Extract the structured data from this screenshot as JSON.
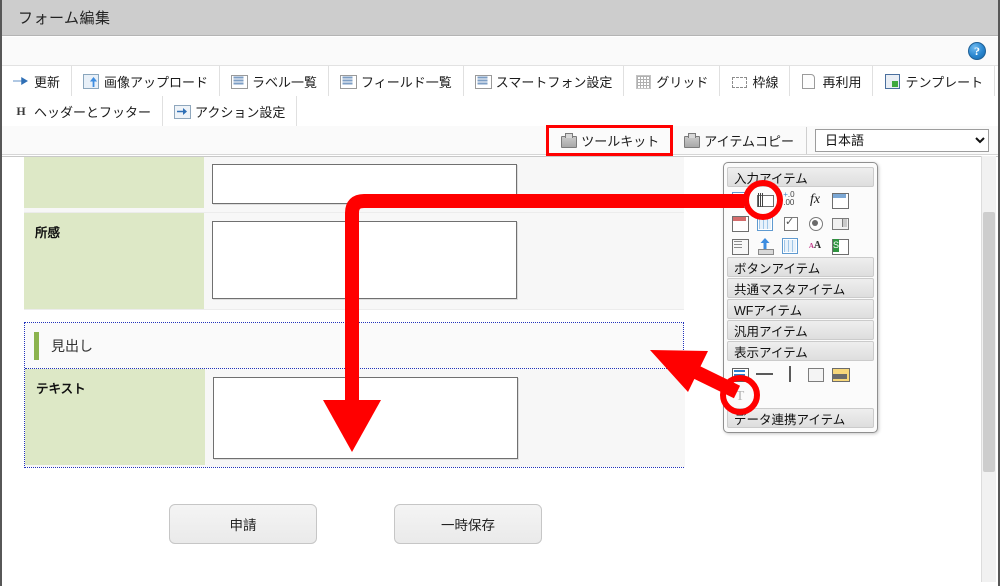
{
  "window": {
    "title": "フォーム編集",
    "help_icon_label": "?"
  },
  "toolbar": {
    "row1": [
      {
        "label": "更新",
        "icon": "refresh-icon"
      },
      {
        "label": "画像アップロード",
        "icon": "image-upload-icon"
      },
      {
        "label": "ラベル一覧",
        "icon": "label-list-icon"
      },
      {
        "label": "フィールド一覧",
        "icon": "field-list-icon"
      },
      {
        "label": "スマートフォン設定",
        "icon": "smartphone-settings-icon"
      },
      {
        "label": "グリッド",
        "icon": "grid-icon"
      },
      {
        "label": "枠線",
        "icon": "border-icon"
      },
      {
        "label": "再利用",
        "icon": "reuse-icon"
      },
      {
        "label": "テンプレート",
        "icon": "template-icon"
      }
    ],
    "row2": [
      {
        "label": "ヘッダーとフッター",
        "icon": "header-footer-icon"
      },
      {
        "label": "アクション設定",
        "icon": "action-settings-icon"
      }
    ]
  },
  "actionbar": {
    "toolkit_label": "ツールキット",
    "item_copy_label": "アイテムコピー",
    "language_selected": "日本語",
    "language_options": [
      "日本語"
    ]
  },
  "form": {
    "rows": [
      {
        "label": "",
        "field_type": "textarea"
      },
      {
        "label": "所感",
        "field_type": "textarea"
      }
    ],
    "selected_group": {
      "heading_text": "見出し",
      "row_label": "テキスト",
      "field_type": "textarea"
    },
    "buttons": [
      {
        "label": "申請"
      },
      {
        "label": "一時保存"
      }
    ]
  },
  "palette": {
    "sections": [
      {
        "title": "入力アイテム",
        "icons": [
          "table-item-icon",
          "text-field-icon",
          "number-field-icon",
          "formula-field-icon",
          "calendar-blue-icon",
          "calendar-red-icon",
          "table-blue-icon",
          "checkbox-icon",
          "radio-button-icon",
          "select-box-icon",
          "list-box-icon",
          "file-upload-icon",
          "table-grid-icon",
          "rich-text-icon",
          "excel-item-icon"
        ]
      },
      {
        "title": "ボタンアイテム",
        "icons": []
      },
      {
        "title": "共通マスタアイテム",
        "icons": []
      },
      {
        "title": "WFアイテム",
        "icons": []
      },
      {
        "title": "汎用アイテム",
        "icons": []
      },
      {
        "title": "表示アイテム",
        "icons": [
          "label-icon",
          "horizontal-rule-icon",
          "vertical-rule-icon",
          "box-icon",
          "image-icon",
          "text-display-icon"
        ]
      },
      {
        "title": "データ連携アイテム",
        "icons": []
      }
    ]
  },
  "annotations": {
    "highlight_color": "#ff0000",
    "highlight_target": "ツールキット",
    "circled_items": [
      "text-field-icon",
      "label-icon"
    ],
    "arrows": [
      {
        "from": "text-field-icon",
        "to": "form-text-area"
      },
      {
        "from": "label-icon",
        "to": "heading-row"
      }
    ]
  }
}
